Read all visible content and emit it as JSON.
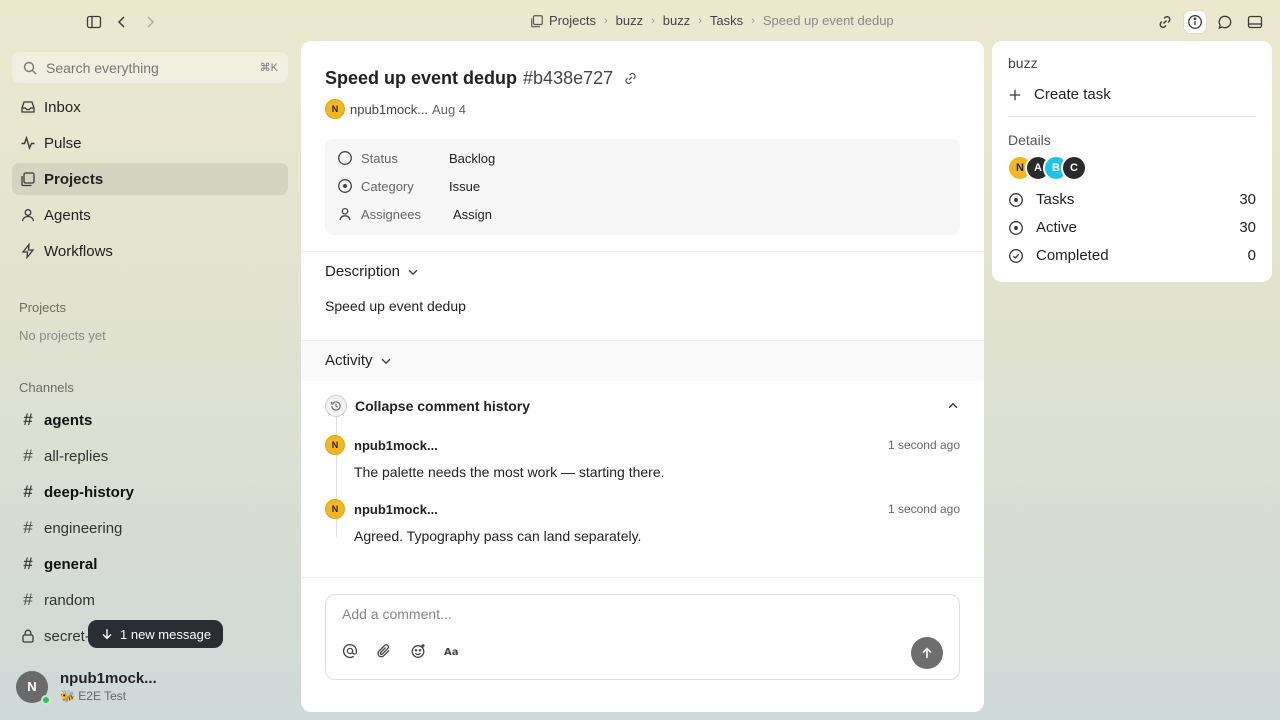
{
  "breadcrumb": {
    "items": [
      "Projects",
      "buzz",
      "buzz",
      "Tasks",
      "Speed up event dedup"
    ]
  },
  "search": {
    "placeholder": "Search everything",
    "shortcut": "⌘K"
  },
  "sidebar": {
    "nav": [
      {
        "label": "Inbox",
        "icon": "inbox-icon",
        "active": false
      },
      {
        "label": "Pulse",
        "icon": "pulse-icon",
        "active": false
      },
      {
        "label": "Projects",
        "icon": "projects-icon",
        "active": true
      },
      {
        "label": "Agents",
        "icon": "agents-icon",
        "active": false
      },
      {
        "label": "Workflows",
        "icon": "workflows-icon",
        "active": false
      }
    ],
    "projects_title": "Projects",
    "projects_empty": "No projects yet",
    "channels_title": "Channels",
    "channels": [
      {
        "name": "agents",
        "bold": true,
        "locked": false
      },
      {
        "name": "all-replies",
        "bold": false,
        "locked": false
      },
      {
        "name": "deep-history",
        "bold": true,
        "locked": false
      },
      {
        "name": "engineering",
        "bold": false,
        "locked": false
      },
      {
        "name": "general",
        "bold": true,
        "locked": false
      },
      {
        "name": "random",
        "bold": false,
        "locked": false
      },
      {
        "name": "secret-",
        "bold": false,
        "locked": true
      }
    ],
    "new_message_pill": "1 new message",
    "user": {
      "initial": "N",
      "name": "npub1mock...",
      "status": "🐝 E2E Test",
      "online_color": "#22c55e"
    }
  },
  "task": {
    "title": "Speed up event dedup",
    "id": "#b438e727",
    "author_initial": "N",
    "author": "npub1mock...",
    "date": "Aug 4",
    "properties": [
      {
        "label": "Status",
        "value": "Backlog",
        "icon": "status-circle-icon"
      },
      {
        "label": "Category",
        "value": "Issue",
        "icon": "category-icon"
      },
      {
        "label": "Assignees",
        "value": "Assign",
        "icon": "person-icon"
      }
    ],
    "description_heading": "Description",
    "description": "Speed up event dedup",
    "activity_heading": "Activity",
    "collapse_label": "Collapse comment history",
    "comments": [
      {
        "initial": "N",
        "author": "npub1mock...",
        "time": "1 second ago",
        "body": "The palette needs the most work — starting there."
      },
      {
        "initial": "N",
        "author": "npub1mock...",
        "time": "1 second ago",
        "body": "Agreed. Typography pass can land separately."
      }
    ],
    "comment_placeholder": "Add a comment..."
  },
  "info_panel": {
    "project_name": "buzz",
    "create_task": "Create task",
    "details_title": "Details",
    "avatars": [
      {
        "initial": "N",
        "bg": "#f1b722",
        "fg": "#222"
      },
      {
        "initial": "A",
        "bg": "#2b2b2b",
        "fg": "#fff"
      },
      {
        "initial": "B",
        "bg": "#22c2e6",
        "fg": "#fff"
      },
      {
        "initial": "C",
        "bg": "#2b2b2b",
        "fg": "#fff"
      }
    ],
    "stats": [
      {
        "label": "Tasks",
        "value": "30"
      },
      {
        "label": "Active",
        "value": "30"
      },
      {
        "label": "Completed",
        "value": "0"
      }
    ]
  },
  "colors": {
    "avatar_yellow": "#f1b722",
    "pill_dark": "#2a2d31",
    "send_button": "#6e6e6e"
  }
}
